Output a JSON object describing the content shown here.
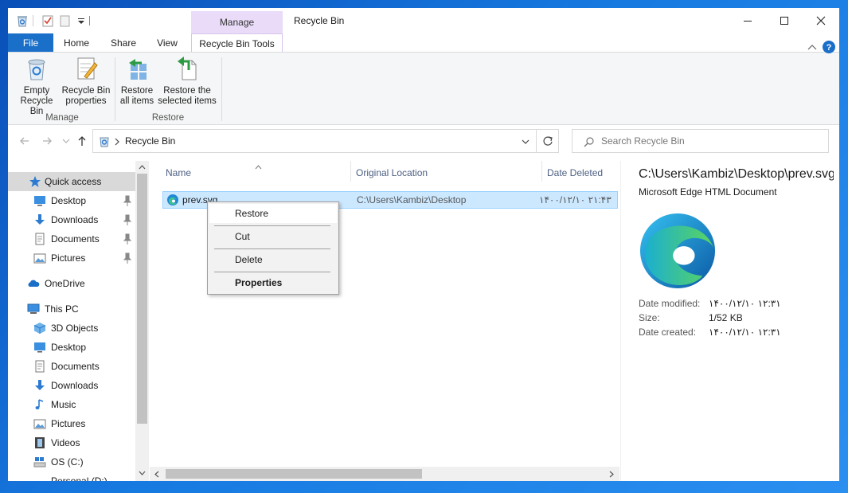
{
  "window": {
    "title": "Recycle Bin",
    "contextual_group": "Manage"
  },
  "ribbon": {
    "tabs": [
      "File",
      "Home",
      "Share",
      "View",
      "Recycle Bin Tools"
    ],
    "active_tab": "Recycle Bin Tools",
    "buttons": {
      "empty": [
        "Empty",
        "Recycle Bin"
      ],
      "properties": [
        "Recycle Bin",
        "properties"
      ],
      "restore_all": [
        "Restore",
        "all items"
      ],
      "restore_selected": [
        "Restore the",
        "selected items"
      ]
    },
    "groups": [
      "Manage",
      "Restore"
    ]
  },
  "address": {
    "path": "Recycle Bin",
    "search_placeholder": "Search Recycle Bin"
  },
  "navpane": {
    "items": [
      {
        "label": "Quick access",
        "icon": "star-icon",
        "selected": true
      },
      {
        "label": "Desktop",
        "icon": "desktop-icon",
        "pinned": true
      },
      {
        "label": "Downloads",
        "icon": "download-arrow-icon",
        "pinned": true
      },
      {
        "label": "Documents",
        "icon": "document-icon",
        "pinned": true
      },
      {
        "label": "Pictures",
        "icon": "picture-icon",
        "pinned": true
      },
      {
        "label": "OneDrive",
        "icon": "cloud-icon"
      },
      {
        "label": "This PC",
        "icon": "computer-icon"
      },
      {
        "label": "3D Objects",
        "icon": "cube-icon"
      },
      {
        "label": "Desktop",
        "icon": "desktop-icon"
      },
      {
        "label": "Documents",
        "icon": "document-icon"
      },
      {
        "label": "Downloads",
        "icon": "download-arrow-icon"
      },
      {
        "label": "Music",
        "icon": "music-note-icon"
      },
      {
        "label": "Pictures",
        "icon": "picture-icon"
      },
      {
        "label": "Videos",
        "icon": "film-icon"
      },
      {
        "label": "OS (C:)",
        "icon": "drive-icon"
      },
      {
        "label": "Personal (D:)",
        "icon": "drive-icon"
      }
    ]
  },
  "filelist": {
    "columns": [
      "Name",
      "Original Location",
      "Date Deleted"
    ],
    "rows": [
      {
        "name": "prev.svg",
        "location": "C:\\Users\\Kambiz\\Desktop",
        "deleted": "۱۴۰۰/۱۲/۱۰ ۲۱:۴۳"
      }
    ]
  },
  "context_menu": {
    "items": [
      "Restore",
      "Cut",
      "Delete",
      "Properties"
    ]
  },
  "details": {
    "title": "C:\\Users\\Kambiz\\Desktop\\prev.svg",
    "type": "Microsoft Edge HTML Document",
    "props": [
      {
        "label": "Date modified:",
        "value": "۱۴۰۰/۱۲/۱۰ ۱۲:۳۱"
      },
      {
        "label": "Size:",
        "value": "1/52 KB"
      },
      {
        "label": "Date created:",
        "value": "۱۴۰۰/۱۲/۱۰ ۱۲:۳۱"
      }
    ]
  },
  "colors": {
    "file_tab": "#1a6fc9",
    "contextual": "#eadcf9",
    "selection": "#cce8ff",
    "selection_border": "#99d1ff",
    "column_text": "#4d6082"
  }
}
